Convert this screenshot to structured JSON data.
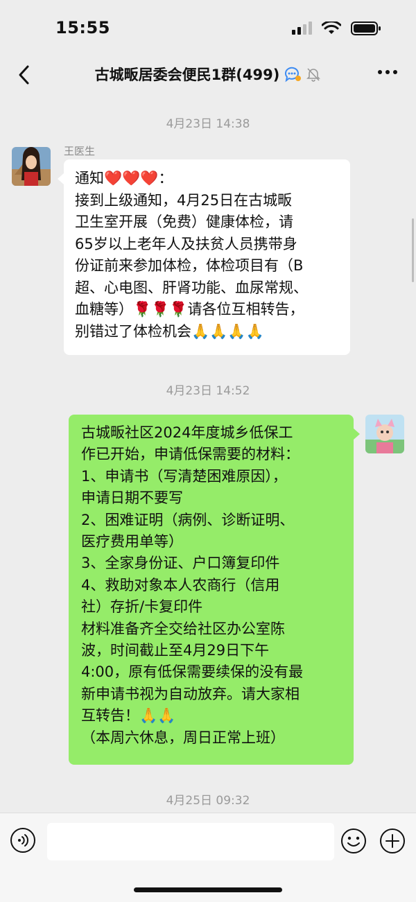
{
  "status_bar": {
    "time": "15:55"
  },
  "header": {
    "title": "古城畈居委会便民1群(499)"
  },
  "timestamps": [
    "4月23日 14:38",
    "4月23日 14:52",
    "4月25日 09:32"
  ],
  "messages": [
    {
      "sender": "王医生",
      "lines": [
        "通知❤️❤️❤️：",
        "接到上级通知，4月25日在古城畈",
        "卫生室开展（免费）健康体检，请",
        "65岁以上老年人及扶贫人员携带身",
        "份证前来参加体检，体检项目有（B",
        "超、心电图、肝肾功能、血尿常规、",
        "血糖等）🌹🌹🌹请各位互相转告，",
        "别错过了体检机会🙏🙏🙏🙏"
      ]
    },
    {
      "lines": [
        "   古城畈社区2024年度城乡低保工",
        "作已开始，申请低保需要的材料：",
        "   1、申请书（写清楚困难原因），",
        "申请日期不要写",
        "   2、困难证明（病例、诊断证明、",
        "医疗费用单等）",
        "   3、全家身份证、户口簿复印件",
        "   4、救助对象本人农商行（信用",
        "社）存折/卡复印件",
        "   材料准备齐全交给社区办公室陈",
        "波，时间截止至4月29日下午",
        "4:00，原有低保需要续保的没有最",
        "新申请书视为自动放弃。请大家相",
        "互转告！🙏🙏",
        "      （本周六休息，周日正常上班）"
      ]
    }
  ],
  "input": {
    "placeholder": ""
  },
  "colors": {
    "background": "#ededed",
    "incoming_bubble": "#ffffff",
    "outgoing_bubble": "#95ec69"
  },
  "icons": [
    "back-icon",
    "group-chat-icon",
    "mute-bell-icon",
    "more-icon",
    "voice-icon",
    "emoji-icon",
    "plus-icon"
  ]
}
